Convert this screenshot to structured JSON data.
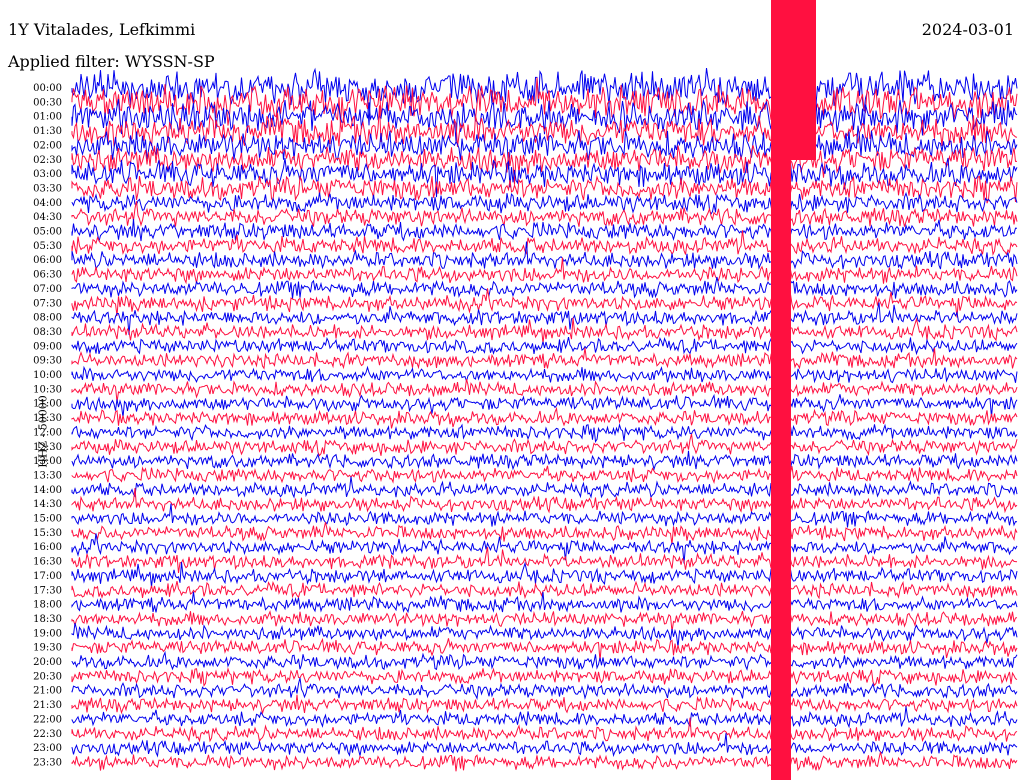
{
  "header": {
    "station": "1Y Vitalades, Lefkimmi",
    "date": "2024-03-01",
    "filter": "Applied filter: WYSSN-SP"
  },
  "chart_data": {
    "type": "line",
    "ylabel": "HHZ - 50000",
    "tick_labels": [
      "00:00",
      "00:30",
      "01:00",
      "01:30",
      "02:00",
      "02:30",
      "03:00",
      "03:30",
      "04:00",
      "04:30",
      "05:00",
      "05:30",
      "06:00",
      "06:30",
      "07:00",
      "07:30",
      "08:00",
      "08:30",
      "09:00",
      "09:30",
      "10:00",
      "10:30",
      "11:00",
      "11:30",
      "12:00",
      "12:30",
      "13:00",
      "13:30",
      "14:00",
      "14:30",
      "15:00",
      "15:30",
      "16:00",
      "16:30",
      "17:00",
      "17:30",
      "18:00",
      "18:30",
      "19:00",
      "19:30",
      "20:00",
      "20:30",
      "21:00",
      "21:30",
      "22:00",
      "22:30",
      "23:00",
      "23:30"
    ],
    "series_colors": [
      "#0000ee",
      "#ff1040"
    ],
    "x_range_minutes": [
      0,
      30
    ],
    "grid": false
  }
}
